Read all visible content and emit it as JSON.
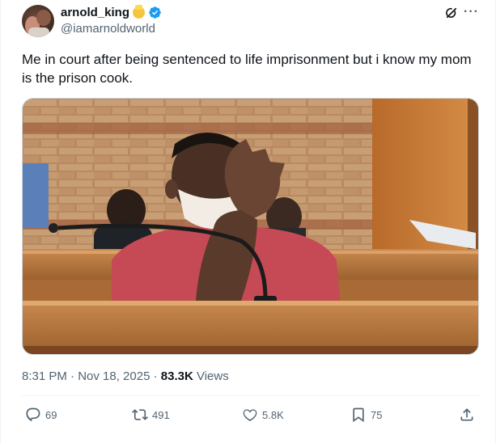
{
  "author": {
    "display_name": "arnold_king",
    "handle": "@iamarnoldworld",
    "badge_emoji": "angel-emoji",
    "verified": true
  },
  "tweet": {
    "text": "Me in court after being sentenced to life imprisonment but i know my mom is the prison cook."
  },
  "meta": {
    "time_date": "8:31 PM · Nov 18, 2025 · ",
    "views_count": "83.3K",
    "views_label": " Views"
  },
  "actions": {
    "replies": "69",
    "reposts": "491",
    "likes": "5.8K",
    "bookmarks": "75"
  },
  "colors": {
    "accent": "#1d9bf0",
    "muted": "#536471",
    "text": "#0f1419"
  },
  "icons": [
    "grok-icon",
    "more-icon",
    "verified-icon",
    "reply-icon",
    "repost-icon",
    "like-icon",
    "bookmark-icon",
    "share-icon"
  ]
}
